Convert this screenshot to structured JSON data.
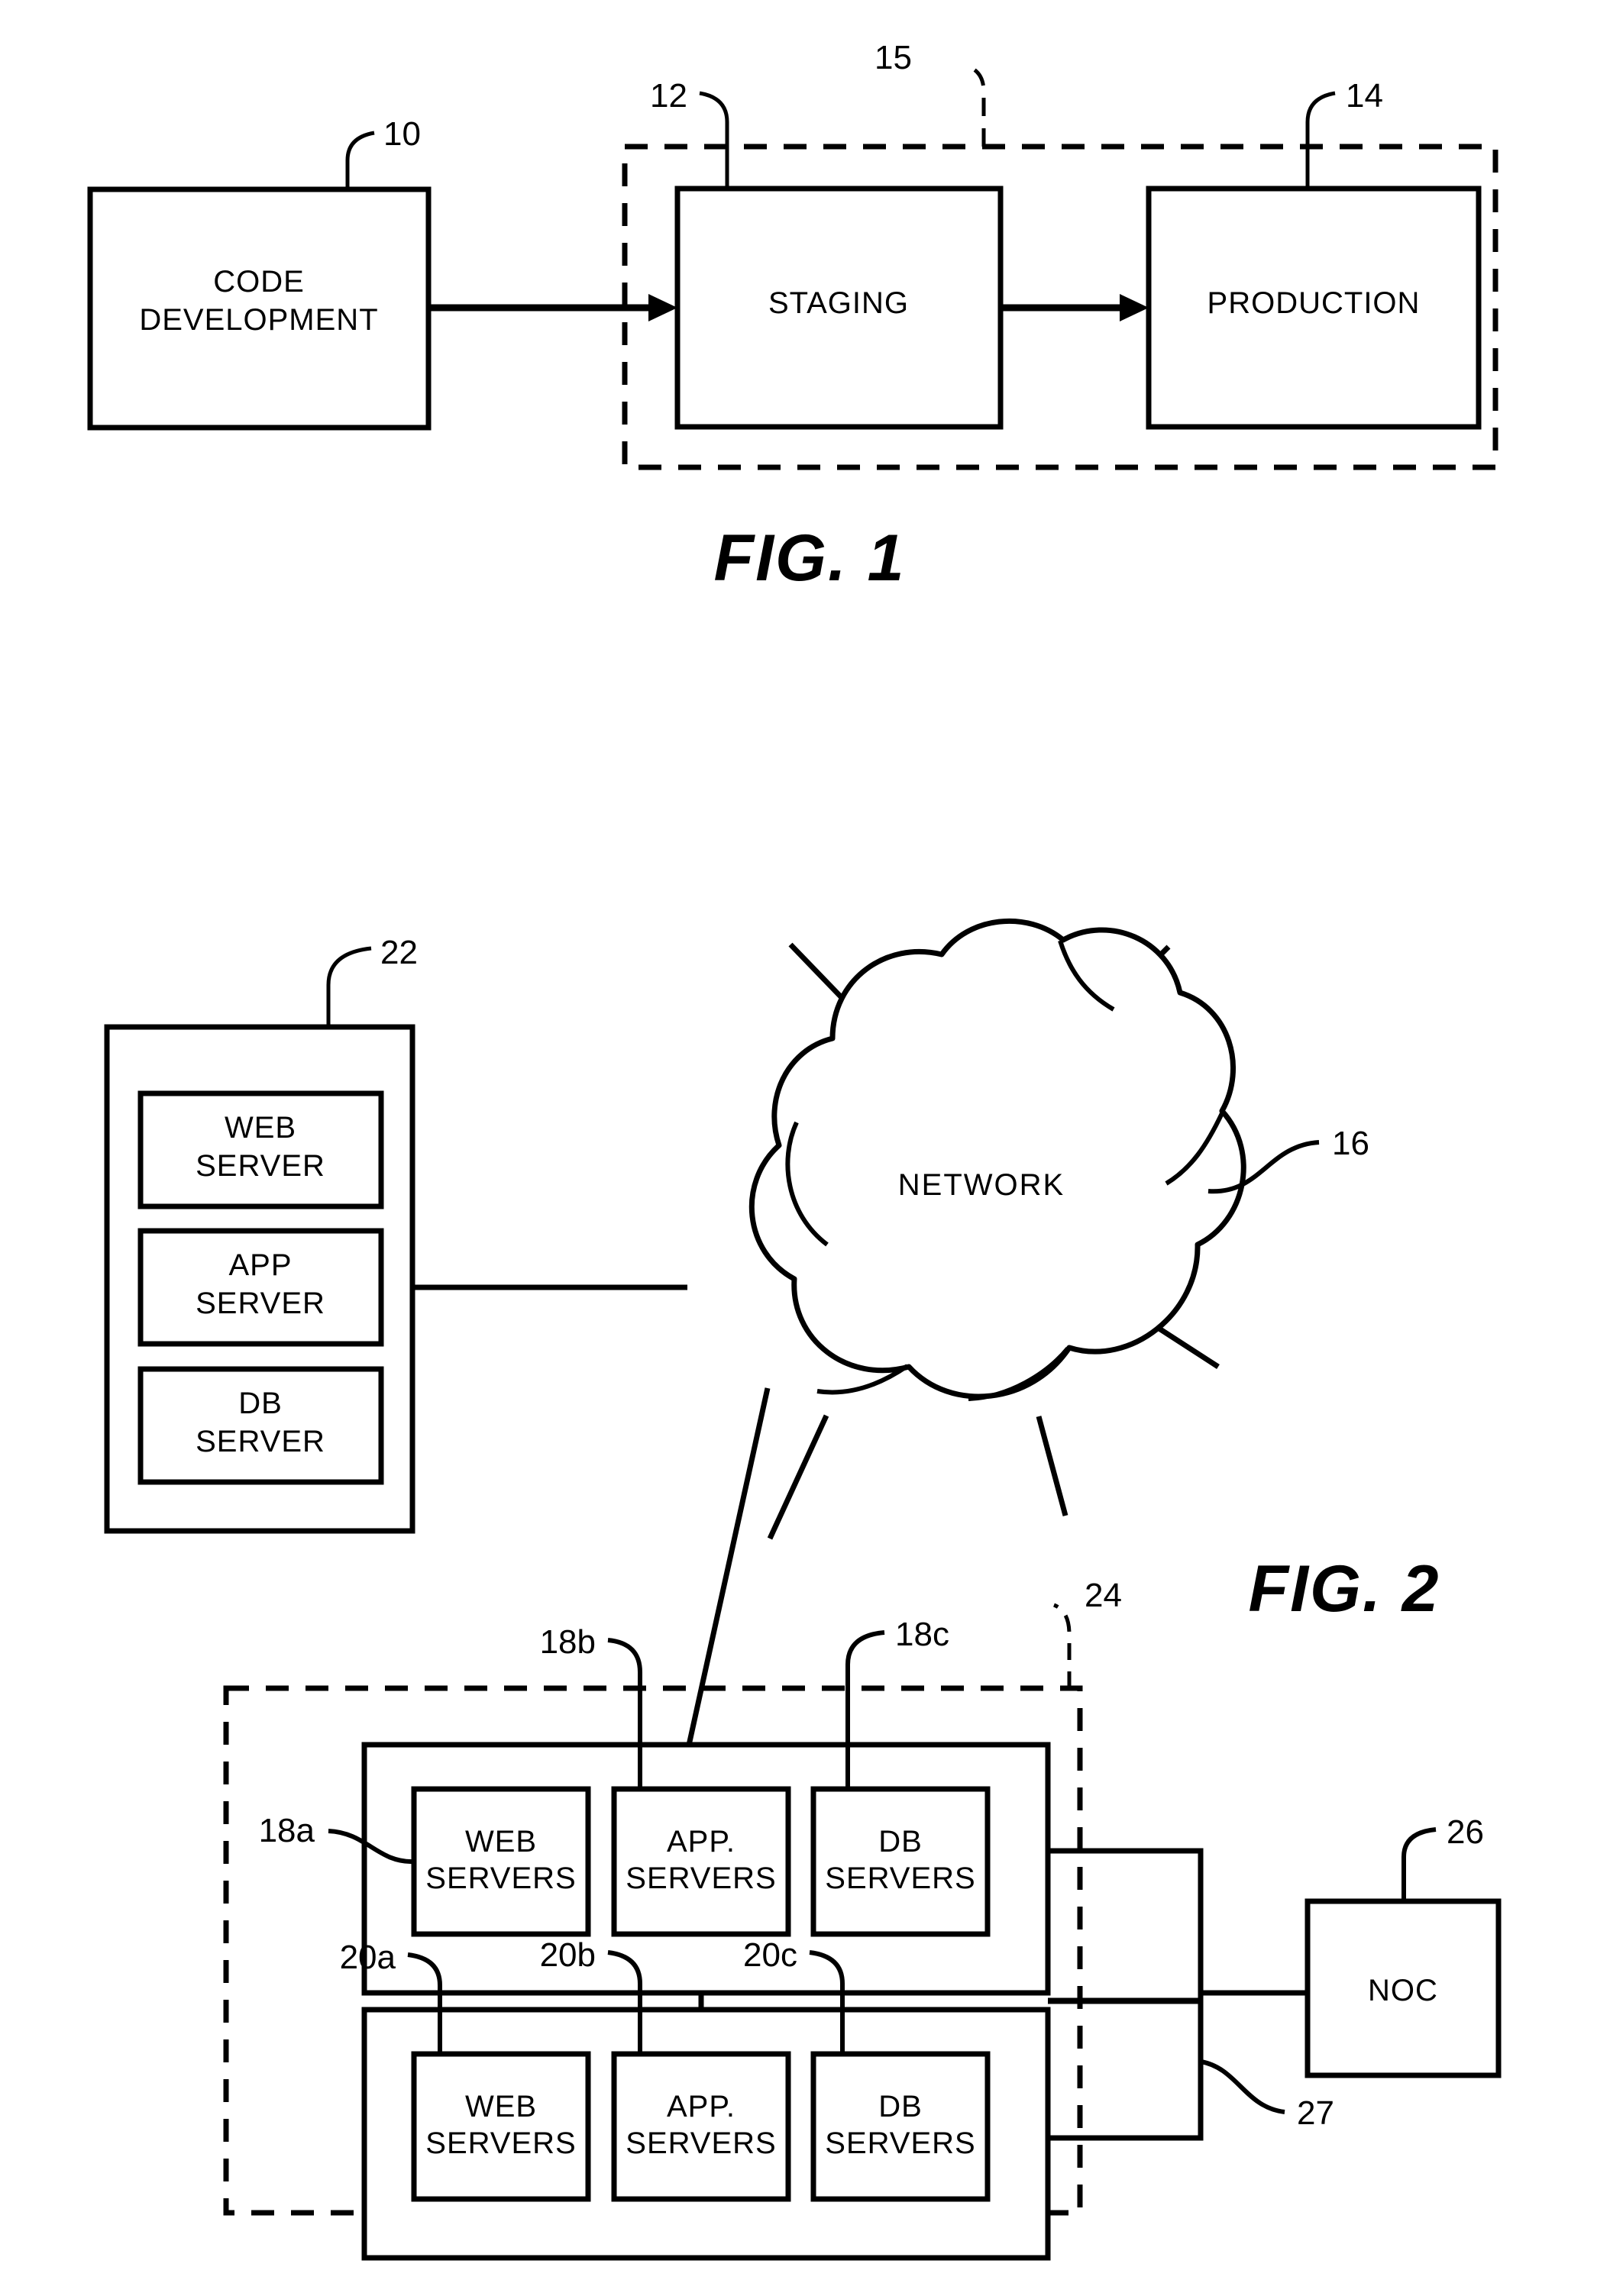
{
  "document": {
    "type": "patent-drawing-sheet",
    "background_color": "#ffffff",
    "line_color": "#000000"
  },
  "figure1": {
    "caption": "FIG. 1",
    "boxes": [
      {
        "id": "code-development",
        "label_line1": "CODE",
        "label_line2": "DEVELOPMENT",
        "ref": "10"
      },
      {
        "id": "staging",
        "label_line1": "STAGING",
        "label_line2": "",
        "ref": "12"
      },
      {
        "id": "production",
        "label_line1": "PRODUCTION",
        "label_line2": "",
        "ref": "14"
      }
    ],
    "dashed_enclosure": {
      "id": "hosting-environment",
      "ref": "15"
    },
    "arrows": [
      {
        "from": "code-development",
        "to": "staging"
      },
      {
        "from": "staging",
        "to": "production"
      }
    ]
  },
  "figure2": {
    "caption": "FIG. 2",
    "network_cloud": {
      "label": "NETWORK",
      "ref": "16"
    },
    "client_rack": {
      "ref": "22",
      "items": [
        {
          "line1": "WEB",
          "line2": "SERVER"
        },
        {
          "line1": "APP",
          "line2": "SERVER"
        },
        {
          "line1": "DB",
          "line2": "SERVER"
        }
      ]
    },
    "data_center": {
      "ref": "24",
      "groups": [
        {
          "id": "production-group",
          "items": [
            {
              "line1": "WEB",
              "line2": "SERVERS",
              "ref": "18a"
            },
            {
              "line1": "APP.",
              "line2": "SERVERS",
              "ref": "18b"
            },
            {
              "line1": "DB",
              "line2": "SERVERS",
              "ref": "18c"
            }
          ]
        },
        {
          "id": "staging-group",
          "items": [
            {
              "line1": "WEB",
              "line2": "SERVERS",
              "ref": "20a"
            },
            {
              "line1": "APP.",
              "line2": "SERVERS",
              "ref": "20b"
            },
            {
              "line1": "DB",
              "line2": "SERVERS",
              "ref": "20c"
            }
          ]
        }
      ]
    },
    "noc": {
      "label": "NOC",
      "ref": "26"
    },
    "noc_link": {
      "ref": "27"
    }
  }
}
